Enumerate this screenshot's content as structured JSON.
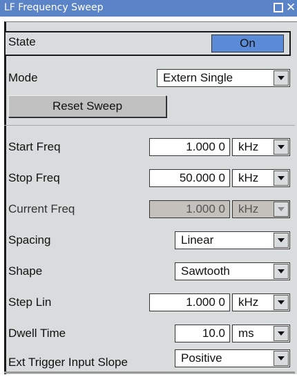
{
  "window": {
    "title": "LF Frequency Sweep"
  },
  "state": {
    "label": "State",
    "value": "On",
    "accent": "#5b8ad6"
  },
  "mode": {
    "label": "Mode",
    "value": "Extern Single"
  },
  "reset_button": {
    "label": "Reset Sweep"
  },
  "start_freq": {
    "label": "Start Freq",
    "value": "1.000 0",
    "unit": "kHz"
  },
  "stop_freq": {
    "label": "Stop Freq",
    "value": "50.000 0",
    "unit": "kHz"
  },
  "current_freq": {
    "label": "Current Freq",
    "value": "1.000 0",
    "unit": "kHz"
  },
  "spacing": {
    "label": "Spacing",
    "value": "Linear"
  },
  "shape": {
    "label": "Shape",
    "value": "Sawtooth"
  },
  "step_lin": {
    "label": "Step Lin",
    "value": "1.000 0",
    "unit": "kHz"
  },
  "dwell_time": {
    "label": "Dwell Time",
    "value": "10.0",
    "unit": "ms"
  },
  "ext_trigger": {
    "label": "Ext Trigger Input Slope",
    "value": "Positive"
  },
  "colors": {
    "titlebar": "#5b83c7",
    "panel": "#d9dcdc",
    "state_on": "#5b8ad6"
  }
}
